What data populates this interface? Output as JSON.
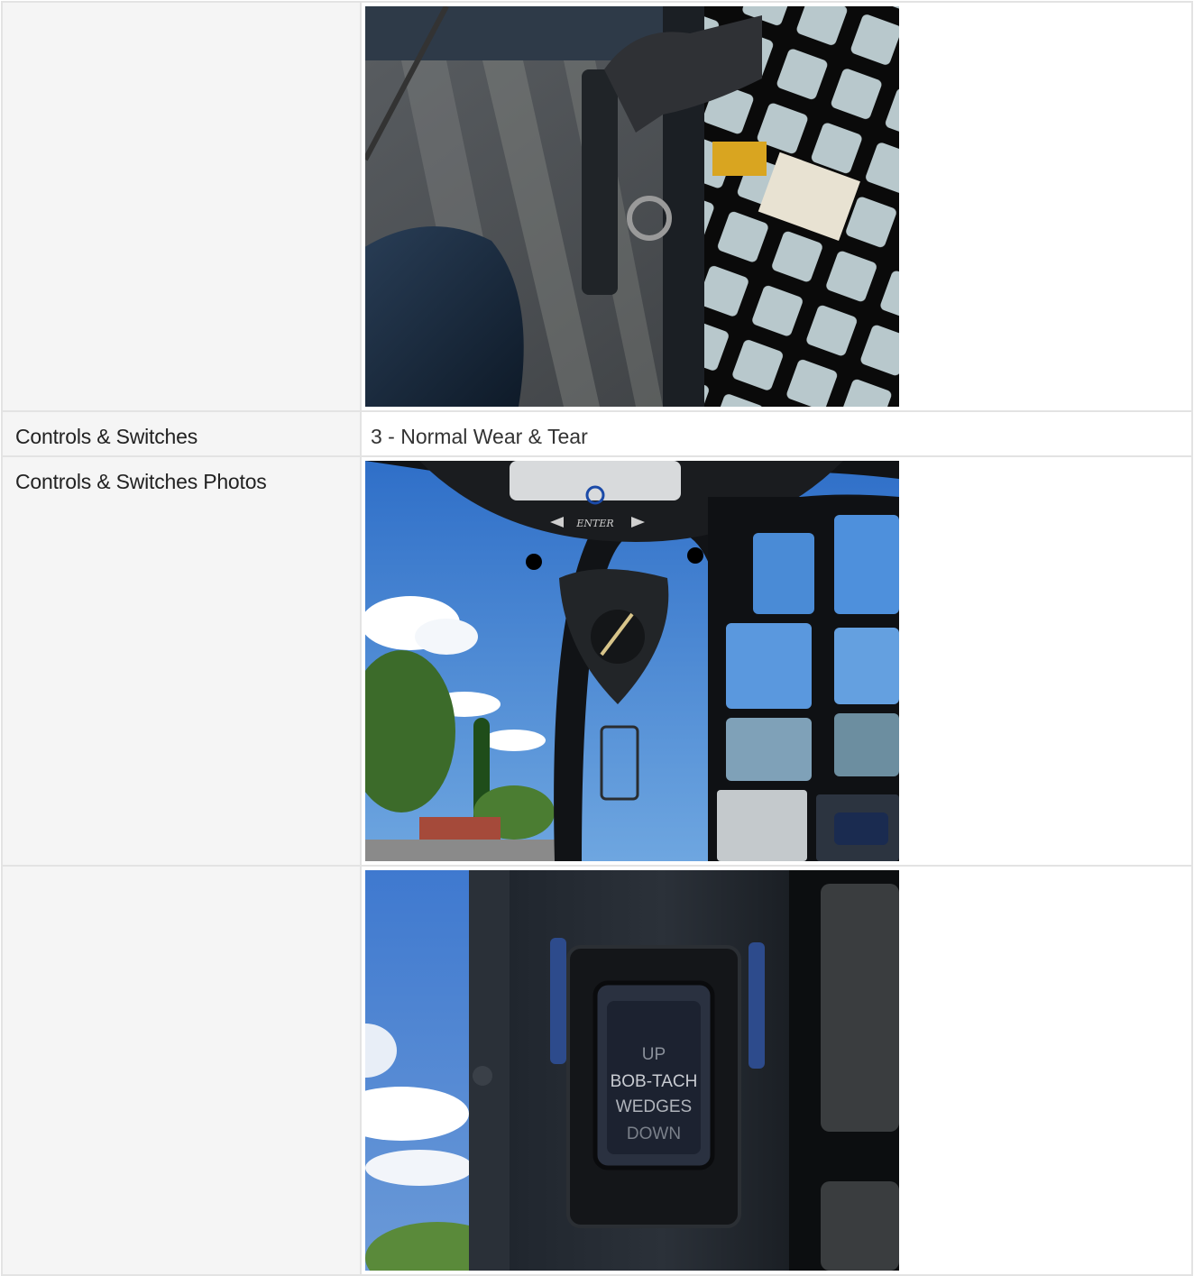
{
  "rows": [
    {
      "label": "",
      "type": "photo",
      "photo_name": "cab-interior-grab-handle-photo"
    },
    {
      "label": "Controls & Switches",
      "type": "text",
      "value": "3 - Normal Wear & Tear"
    },
    {
      "label": "Controls & Switches Photos",
      "type": "photo",
      "photo_name": "instrument-panel-photo"
    },
    {
      "label": "",
      "type": "photo",
      "photo_name": "bob-tach-switch-photo"
    }
  ],
  "photo2_text": {
    "enter": "ENTER"
  },
  "photo3_text": {
    "line1": "UP",
    "line2": "BOB-TACH",
    "line3": "WEDGES",
    "line4": "DOWN"
  },
  "colors": {
    "label_bg": "#f5f5f5",
    "border": "#e3e3e3",
    "sky": "#3f7fd0"
  }
}
